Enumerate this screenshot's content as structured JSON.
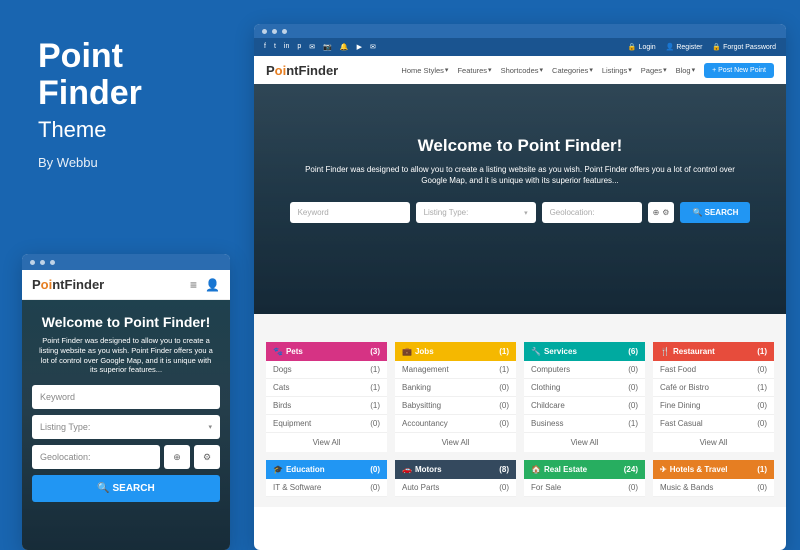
{
  "title": {
    "line1": "Point",
    "line2": "Finder",
    "sub": "Theme",
    "by": "By Webbu"
  },
  "logo": {
    "p1": "P",
    "oo": "oi",
    "p2": "ntFinder"
  },
  "mobile": {
    "heading": "Welcome to Point Finder!",
    "desc": "Point Finder was designed to allow you to create a listing website as you wish. Point Finder offers you a lot of control over Google Map, and it is unique with its superior features...",
    "keyword": "Keyword",
    "listing": "Listing Type:",
    "geo": "Geolocation:",
    "search": "🔍 SEARCH"
  },
  "topbar": {
    "social": [
      "f",
      "t",
      "in",
      "p",
      "✉",
      "📷",
      "🔔",
      "▶",
      "✉"
    ],
    "login": "🔒 Login",
    "register": "👤 Register",
    "forgot": "🔒 Forgot Password"
  },
  "nav": {
    "items": [
      "Home Styles",
      "Features",
      "Shortcodes",
      "Categories",
      "Listings",
      "Pages",
      "Blog"
    ],
    "post": "+ Post New Point"
  },
  "hero": {
    "heading": "Welcome to Point Finder!",
    "desc": "Point Finder was designed to allow you to create a listing website as you wish. Point Finder offers you a lot of control over Google Map, and it is unique with its superior features...",
    "keyword": "Keyword",
    "listing": "Listing Type:",
    "geo": "Geolocation:",
    "search": "🔍 SEARCH"
  },
  "cats": [
    {
      "color": "#d63384",
      "icon": "🐾",
      "name": "Pets",
      "count": "(3)",
      "rows": [
        [
          "Dogs",
          "(1)"
        ],
        [
          "Cats",
          "(1)"
        ],
        [
          "Birds",
          "(1)"
        ],
        [
          "Equipment",
          "(0)"
        ]
      ],
      "view": "View All"
    },
    {
      "color": "#f5b800",
      "icon": "💼",
      "name": "Jobs",
      "count": "(1)",
      "rows": [
        [
          "Management",
          "(1)"
        ],
        [
          "Banking",
          "(0)"
        ],
        [
          "Babysitting",
          "(0)"
        ],
        [
          "Accountancy",
          "(0)"
        ]
      ],
      "view": "View All"
    },
    {
      "color": "#00aaa0",
      "icon": "🔧",
      "name": "Services",
      "count": "(6)",
      "rows": [
        [
          "Computers",
          "(0)"
        ],
        [
          "Clothing",
          "(0)"
        ],
        [
          "Childcare",
          "(0)"
        ],
        [
          "Business",
          "(1)"
        ]
      ],
      "view": "View All"
    },
    {
      "color": "#e74c3c",
      "icon": "🍴",
      "name": "Restaurant",
      "count": "(1)",
      "rows": [
        [
          "Fast Food",
          "(0)"
        ],
        [
          "Café or Bistro",
          "(1)"
        ],
        [
          "Fine Dining",
          "(0)"
        ],
        [
          "Fast Casual",
          "(0)"
        ]
      ],
      "view": "View All"
    },
    {
      "color": "#2196f3",
      "icon": "🎓",
      "name": "Education",
      "count": "(0)",
      "rows": [
        [
          "IT & Software",
          "(0)"
        ]
      ],
      "view": ""
    },
    {
      "color": "#34495e",
      "icon": "🚗",
      "name": "Motors",
      "count": "(8)",
      "rows": [
        [
          "Auto Parts",
          "(0)"
        ]
      ],
      "view": ""
    },
    {
      "color": "#27ae60",
      "icon": "🏠",
      "name": "Real Estate",
      "count": "(24)",
      "rows": [
        [
          "For Sale",
          "(0)"
        ]
      ],
      "view": ""
    },
    {
      "color": "#e67e22",
      "icon": "✈",
      "name": "Hotels & Travel",
      "count": "(1)",
      "rows": [
        [
          "Music & Bands",
          "(0)"
        ]
      ],
      "view": ""
    }
  ]
}
